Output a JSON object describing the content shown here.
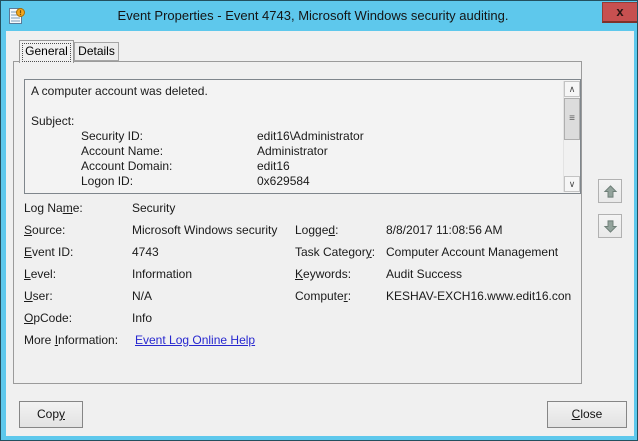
{
  "colors": {
    "titlebar": "#5ec8ec",
    "close_button": "#c75050",
    "link": "#2727cf"
  },
  "window": {
    "title": "Event Properties - Event 4743, Microsoft Windows security auditing.",
    "close_glyph": "x"
  },
  "tabs": {
    "general": "General",
    "details": "Details"
  },
  "description": {
    "line1": "A computer account was deleted.",
    "subject": "Subject:",
    "fields": [
      {
        "label": "Security ID:",
        "value": "edit16\\Administrator"
      },
      {
        "label": "Account Name:",
        "value": "Administrator"
      },
      {
        "label": "Account Domain:",
        "value": "edit16"
      },
      {
        "label": "Logon ID:",
        "value": "0x629584"
      }
    ]
  },
  "scrollbar": {
    "up_glyph": "∧",
    "down_glyph": "∨",
    "grip_glyph": "≡"
  },
  "details_grid": {
    "left": [
      {
        "pre": "Log Na",
        "accel": "m",
        "post": "e:",
        "value": "Security"
      },
      {
        "pre": "",
        "accel": "S",
        "post": "ource:",
        "value": "Microsoft Windows security"
      },
      {
        "pre": "",
        "accel": "E",
        "post": "vent ID:",
        "value": "4743"
      },
      {
        "pre": "",
        "accel": "L",
        "post": "evel:",
        "value": "Information"
      },
      {
        "pre": "",
        "accel": "U",
        "post": "ser:",
        "value": "N/A"
      },
      {
        "pre": "",
        "accel": "O",
        "post": "pCode:",
        "value": "Info"
      }
    ],
    "right": [
      {
        "pre": "Logge",
        "accel": "d",
        "post": ":",
        "value": "8/8/2017 11:08:56 AM"
      },
      {
        "pre": "Task Categor",
        "accel": "y",
        "post": ":",
        "value": "Computer Account Management"
      },
      {
        "pre": "",
        "accel": "K",
        "post": "eywords:",
        "value": "Audit Success"
      },
      {
        "pre": "Compute",
        "accel": "r",
        "post": ":",
        "value": "KESHAV-EXCH16.www.edit16.con"
      }
    ],
    "more_info": {
      "pre": "More ",
      "accel": "I",
      "post": "nformation:",
      "link": "Event Log Online Help"
    }
  },
  "buttons": {
    "copy": {
      "pre": "Cop",
      "accel": "y",
      "post": ""
    },
    "close": {
      "pre": "",
      "accel": "C",
      "post": "lose"
    }
  }
}
